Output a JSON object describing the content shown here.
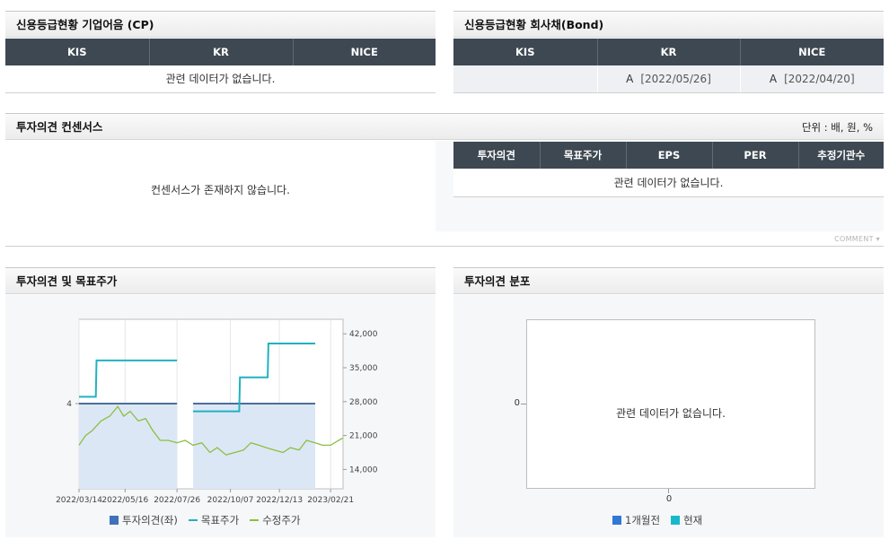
{
  "credit_cp": {
    "title": "신용등급현황 기업어음 (CP)",
    "columns": [
      "KIS",
      "KR",
      "NICE"
    ],
    "empty_text": "관련 데이터가 없습니다."
  },
  "credit_bond": {
    "title": "신용등급현황 회사채(Bond)",
    "columns": [
      "KIS",
      "KR",
      "NICE"
    ],
    "kr_grade": "A",
    "kr_date": "[2022/05/26]",
    "nice_grade": "A",
    "nice_date": "[2022/04/20]"
  },
  "consensus": {
    "title": "투자의견 컨센서스",
    "unit": "단위 : 배, 원, %",
    "empty_text": "컨센서스가 존재하지 않습니다.",
    "columns": [
      "투자의견",
      "목표주가",
      "EPS",
      "PER",
      "추정기관수"
    ],
    "table_empty_text": "관련 데이터가 없습니다.",
    "comment_label": "COMMENT"
  },
  "opinion_target": {
    "title": "투자의견 및 목표주가",
    "left_tick": "4",
    "legend": {
      "opinion": "투자의견(좌)",
      "target": "목표주가",
      "price": "수정주가"
    },
    "colors": {
      "opinion": "#3f72b8",
      "target": "#20b2c0",
      "price": "#8cbf3f",
      "opinion_fill": "#dce7f6"
    }
  },
  "distribution": {
    "title": "투자의견 분포",
    "y_tick": "0",
    "x_tick": "0",
    "empty_text": "관련 데이터가 없습니다.",
    "legend": {
      "prev": "1개월전",
      "now": "현재"
    },
    "colors": {
      "prev": "#2f78d6",
      "now": "#19b8c9"
    }
  },
  "chart_data": {
    "type": "line",
    "title": "",
    "x_ticks": [
      "2022/03/14",
      "2022/05/16",
      "2022/07/26",
      "2022/10/07",
      "2022/12/13",
      "2023/02/21"
    ],
    "x_range": [
      "2022/03/14",
      "2023/03/10"
    ],
    "y_right_ticks": [
      "42,000",
      "35,000",
      "28,000",
      "21,000",
      "14,000"
    ],
    "y_right_range": [
      10000,
      45000
    ],
    "series": [
      {
        "name": "목표주가",
        "points": [
          [
            "2022/03/14",
            29000
          ],
          [
            "2022/04/06",
            29000
          ],
          [
            "2022/04/07",
            36500
          ],
          [
            "2022/07/26",
            36500
          ],
          [
            "2022/08/17",
            26000
          ],
          [
            "2022/10/19",
            26000
          ],
          [
            "2022/10/20",
            33000
          ],
          [
            "2022/11/27",
            33000
          ],
          [
            "2022/11/28",
            40000
          ],
          [
            "2023/01/31",
            40000
          ]
        ]
      },
      {
        "name": "투자의견(좌)",
        "points": [
          [
            "2022/03/14",
            4
          ],
          [
            "2022/07/26",
            4
          ],
          [
            "2022/08/17",
            4
          ],
          [
            "2023/01/31",
            4
          ]
        ]
      },
      {
        "name": "수정주가",
        "points": [
          [
            "2022/03/14",
            19000
          ],
          [
            "2022/03/23",
            21000
          ],
          [
            "2022/04/01",
            22000
          ],
          [
            "2022/04/13",
            24000
          ],
          [
            "2022/04/25",
            25000
          ],
          [
            "2022/05/06",
            27000
          ],
          [
            "2022/05/14",
            25000
          ],
          [
            "2022/05/23",
            26000
          ],
          [
            "2022/06/03",
            24000
          ],
          [
            "2022/06/13",
            24500
          ],
          [
            "2022/06/23",
            22000
          ],
          [
            "2022/07/03",
            20000
          ],
          [
            "2022/07/14",
            20000
          ],
          [
            "2022/07/26",
            19500
          ],
          [
            "2022/08/06",
            20000
          ],
          [
            "2022/08/17",
            19000
          ],
          [
            "2022/08/29",
            19500
          ],
          [
            "2022/09/09",
            17500
          ],
          [
            "2022/09/19",
            18500
          ],
          [
            "2022/10/01",
            17000
          ],
          [
            "2022/10/13",
            17500
          ],
          [
            "2022/10/25",
            18000
          ],
          [
            "2022/11/04",
            19500
          ],
          [
            "2022/11/15",
            19000
          ],
          [
            "2022/11/25",
            18500
          ],
          [
            "2022/12/06",
            18000
          ],
          [
            "2022/12/18",
            17500
          ],
          [
            "2022/12/28",
            18500
          ],
          [
            "2023/01/09",
            18000
          ],
          [
            "2023/01/19",
            20000
          ],
          [
            "2023/01/31",
            19500
          ],
          [
            "2023/02/10",
            19000
          ],
          [
            "2023/02/21",
            19000
          ],
          [
            "2023/03/04",
            20000
          ],
          [
            "2023/03/10",
            20500
          ]
        ]
      }
    ],
    "opinion_bands": [
      [
        "2022/03/14",
        "2022/07/26"
      ],
      [
        "2022/08/17",
        "2023/01/31"
      ]
    ]
  }
}
